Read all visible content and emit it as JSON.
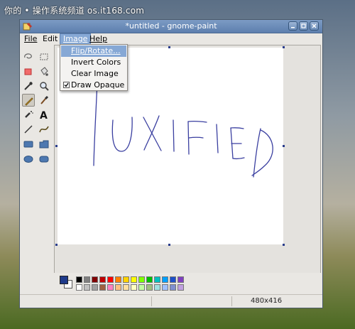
{
  "watermark": {
    "prefix": "你的",
    "dot": "•",
    "text": "操作系统频道 os.it168.com"
  },
  "window": {
    "title": "*untitled - gnome-paint",
    "controls": [
      "minimize",
      "maximize",
      "close"
    ]
  },
  "menubar": {
    "file": "File",
    "edit": "Edit",
    "image": "Image",
    "help": "Help"
  },
  "image_menu": {
    "items": [
      {
        "label": "Flip/Rotate...",
        "highlighted": true
      },
      {
        "label": "Invert Colors"
      },
      {
        "label": "Clear Image"
      },
      {
        "label": "Draw Opaque",
        "checked": true
      }
    ]
  },
  "canvas": {
    "drawing_text": "UXIFIED",
    "stroke_color": "#3a3fa0"
  },
  "tools": [
    "lasso-select-icon",
    "rectangle-select-icon",
    "eraser-icon",
    "fill-bucket-icon",
    "color-picker-icon",
    "zoom-icon",
    "pencil-icon",
    "paintbrush-icon",
    "airbrush-icon",
    "text-icon",
    "line-icon",
    "curve-icon",
    "rectangle-icon",
    "polygon-icon",
    "ellipse-icon",
    "rounded-rectangle-icon"
  ],
  "palette": {
    "primary": "#1e3a8a",
    "secondary": "#ffffff",
    "row1": [
      "#000000",
      "#808080",
      "#800000",
      "#c00000",
      "#ff0000",
      "#ff8000",
      "#ffd200",
      "#ffff00",
      "#80ff00",
      "#00c000",
      "#00c0c0",
      "#00a0ff",
      "#1e50c8",
      "#8040c0"
    ],
    "row2": [
      "#ffffff",
      "#c0c0c0",
      "#a0a0a0",
      "#a06040",
      "#ff80c0",
      "#ffc080",
      "#ffe0a0",
      "#ffffc0",
      "#c0ffa0",
      "#a0c080",
      "#a0e0e0",
      "#a0c0ff",
      "#8090d0",
      "#c0a0e0"
    ]
  },
  "status": {
    "size": "480x416"
  }
}
